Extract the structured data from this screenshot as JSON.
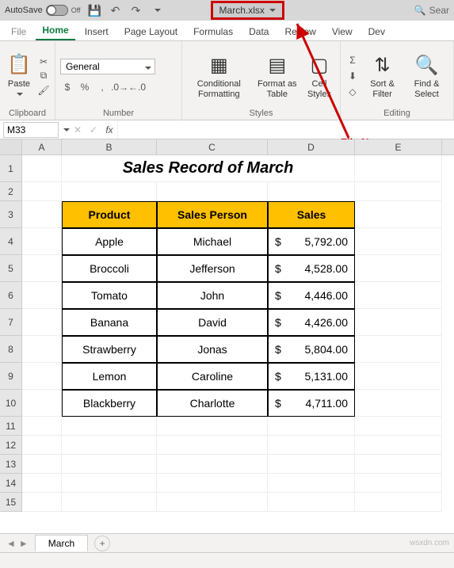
{
  "titlebar": {
    "autosave_label": "AutoSave",
    "autosave_state": "Off",
    "filename": "March.xlsx"
  },
  "search": {
    "label": "Sear"
  },
  "menu": {
    "file": "File",
    "home": "Home",
    "insert": "Insert",
    "page_layout": "Page Layout",
    "formulas": "Formulas",
    "data": "Data",
    "review": "Review",
    "view": "View",
    "dev": "Dev"
  },
  "ribbon": {
    "clipboard": {
      "paste": "Paste",
      "label": "Clipboard"
    },
    "number": {
      "format": "General",
      "label": "Number"
    },
    "styles": {
      "conditional": "Conditional Formatting",
      "format_table": "Format as Table",
      "cell_styles": "Cell Styles",
      "label": "Styles"
    },
    "editing": {
      "sort": "Sort & Filter",
      "find": "Find & Select",
      "label": "Editing"
    }
  },
  "formula_bar": {
    "name_box": "M33",
    "fx": "fx"
  },
  "annotation": {
    "label": "File Name"
  },
  "columns": {
    "A": "A",
    "B": "B",
    "C": "C",
    "D": "D",
    "E": "E"
  },
  "sheet": {
    "title": "Sales Record of March",
    "headers": {
      "product": "Product",
      "person": "Sales Person",
      "sales": "Sales"
    },
    "rows": [
      {
        "product": "Apple",
        "person": "Michael",
        "sales": "5,792.00"
      },
      {
        "product": "Broccoli",
        "person": "Jefferson",
        "sales": "4,528.00"
      },
      {
        "product": "Tomato",
        "person": "John",
        "sales": "4,446.00"
      },
      {
        "product": "Banana",
        "person": "David",
        "sales": "4,426.00"
      },
      {
        "product": "Strawberry",
        "person": "Jonas",
        "sales": "5,804.00"
      },
      {
        "product": "Lemon",
        "person": "Caroline",
        "sales": "5,131.00"
      },
      {
        "product": "Blackberry",
        "person": "Charlotte",
        "sales": "4,711.00"
      }
    ],
    "currency": "$"
  },
  "sheet_tab": {
    "name": "March"
  },
  "watermark": "wsxdn.com"
}
